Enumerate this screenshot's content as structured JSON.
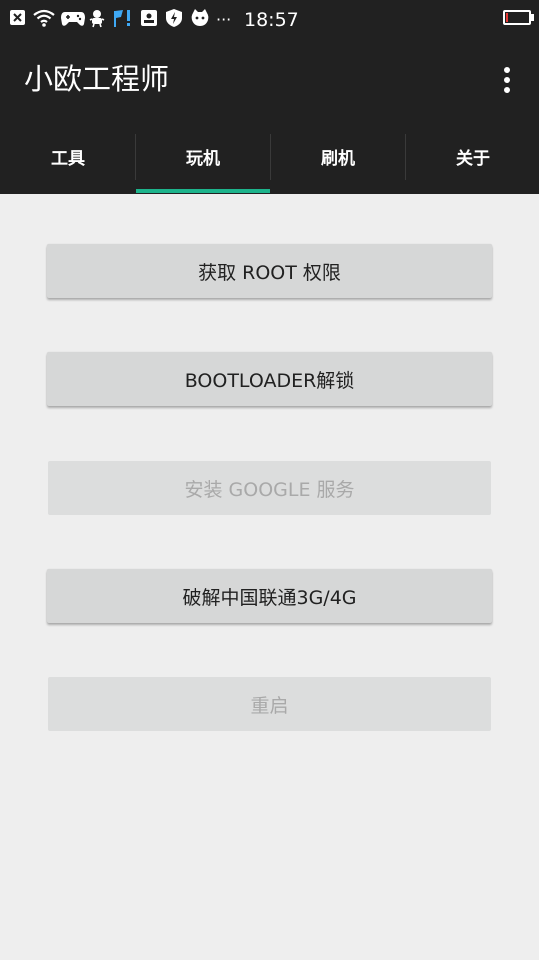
{
  "status_bar": {
    "time": "18:57",
    "battery_level": 0.08,
    "icons": [
      "close-notification-icon",
      "wifi-icon",
      "gamepad-icon",
      "robot-icon",
      "flag-alert-icon",
      "id-card-icon",
      "shield-icon",
      "android-cat-icon",
      "more-dots-icon"
    ],
    "more_text": "···"
  },
  "app_bar": {
    "title": "小欧工程师",
    "menu_icon": "more-vert-icon"
  },
  "tabs": [
    {
      "label": "工具"
    },
    {
      "label": "玩机"
    },
    {
      "label": "刷机"
    },
    {
      "label": "关于"
    }
  ],
  "active_tab_index": 1,
  "buttons": [
    {
      "label": "获取 ROOT 权限",
      "enabled": true
    },
    {
      "label": "BOOTLOADER解锁",
      "enabled": true
    },
    {
      "label": "安装 GOOGLE 服务",
      "enabled": false
    },
    {
      "label": "破解中国联通3G/4G",
      "enabled": true
    },
    {
      "label": "重启",
      "enabled": false
    }
  ],
  "colors": {
    "header_bg": "#212121",
    "tab_indicator": "#1db48c",
    "content_bg": "#eeeeee",
    "button_bg": "#d6d7d7",
    "button_text": "#212121",
    "disabled_text": "#a9a9a9",
    "battery_low": "#e53935"
  }
}
